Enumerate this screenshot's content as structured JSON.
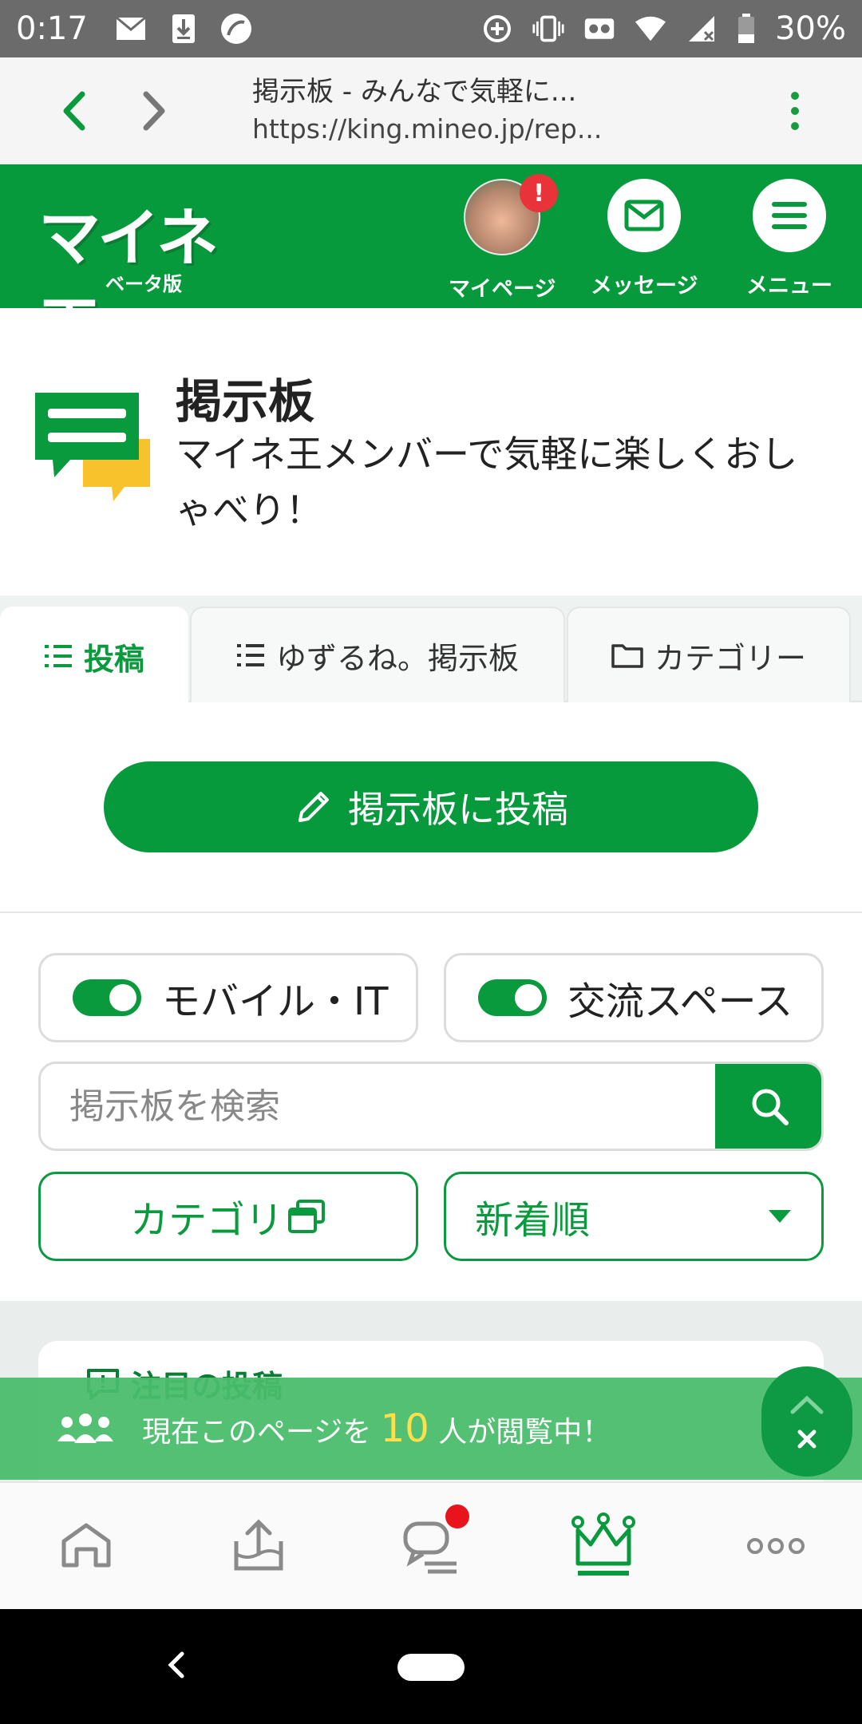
{
  "status_bar": {
    "time": "0:17",
    "battery": "30%",
    "left_icons": [
      "mail-icon",
      "download-icon",
      "app-icon"
    ],
    "right_icons": [
      "data-saver-icon",
      "vibrate-icon",
      "cast-icon",
      "wifi-icon",
      "signal-icon",
      "battery-icon"
    ]
  },
  "browser": {
    "page_title": "掲示板 - みんなで気軽に...",
    "url": "https://king.mineo.jp/rep..."
  },
  "site_header": {
    "logo": "マイネ王",
    "logo_sub": "ベータ版",
    "mypage_label": "マイページ",
    "mypage_badge": "!",
    "message_label": "メッセージ",
    "menu_label": "メニュー",
    "brand_color": "#069a3d"
  },
  "board": {
    "title": "掲示板",
    "description": "マイネ王メンバーで気軽に楽しくおしゃべり！"
  },
  "tabs": [
    {
      "label": "投稿",
      "active": true
    },
    {
      "label": "ゆずるね。掲示板",
      "active": false
    },
    {
      "label": "カテゴリー",
      "active": false
    }
  ],
  "post_button": {
    "label": "掲示板に投稿"
  },
  "filters": {
    "toggle1": {
      "label": "モバイル・IT",
      "on": true
    },
    "toggle2": {
      "label": "交流スペース",
      "on": true
    },
    "search_placeholder": "掲示板を検索",
    "category_label": "カテゴリ",
    "sort_label": "新着順"
  },
  "notice": {
    "title": "注目の投稿"
  },
  "live_banner": {
    "prefix": "現在このページを",
    "count": "10",
    "suffix": "人が閲覧中！"
  },
  "bottom_nav": [
    {
      "icon": "home-icon"
    },
    {
      "icon": "upload-icon"
    },
    {
      "icon": "chat-icon",
      "badge": true
    },
    {
      "icon": "crown-icon",
      "active": true
    },
    {
      "icon": "more-icon"
    }
  ]
}
